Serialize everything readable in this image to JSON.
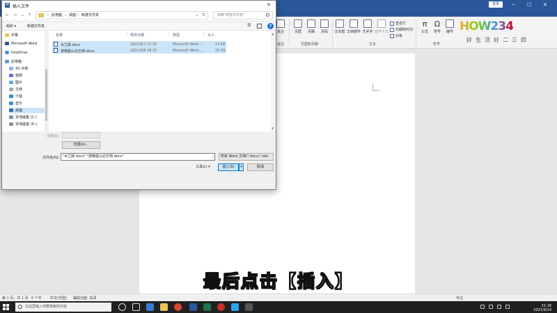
{
  "word": {
    "login_label": "登录",
    "ribbon_groups": {
      "comment": "批注",
      "header_footer": "页眉和页脚",
      "text": "文本",
      "symbol": "符号"
    },
    "ribbon_buttons": {
      "comment": "批注",
      "header": "页眉",
      "footer": "页脚",
      "page_number": "页码",
      "textbox": "文本框",
      "doc_parts": "文档部件",
      "wordart": "艺术字",
      "dropcap": "首字下沉",
      "signature_line": "签名行",
      "date_time": "日期和时间",
      "object": "对象",
      "equation": "公式",
      "symbol": "符号",
      "number": "编号"
    },
    "logo_text": "HOW234",
    "logo_sub": "好生活好二三四"
  },
  "dialog": {
    "title": "插入文件",
    "close_glyph": "✕",
    "breadcrumbs": [
      "此电脑",
      "桌面",
      "新建文件夹"
    ],
    "search_placeholder": "搜索\"新建文件夹\"",
    "organize_label": "组织 ▾",
    "new_folder_label": "新建文件夹",
    "nav_items": [
      {
        "label": "字幕",
        "icon": "folder-icon"
      },
      {
        "label": "Microsoft Word",
        "icon": "word-icon"
      },
      {
        "label": "OneDrive",
        "icon": "cloud-icon"
      },
      {
        "label": "此电脑",
        "icon": "computer-icon"
      },
      {
        "label": "3D 对象",
        "icon": "cube-icon"
      },
      {
        "label": "视频",
        "icon": "video-icon"
      },
      {
        "label": "图片",
        "icon": "picture-icon"
      },
      {
        "label": "文档",
        "icon": "document-icon"
      },
      {
        "label": "下载",
        "icon": "download-icon"
      },
      {
        "label": "音乐",
        "icon": "music-icon"
      },
      {
        "label": "桌面",
        "icon": "desktop-icon"
      },
      {
        "label": "本地磁盘 (C:)",
        "icon": "drive-icon"
      },
      {
        "label": "本地磁盘 (D:)",
        "icon": "drive-icon"
      }
    ],
    "columns": {
      "name": "名称",
      "modified": "修改日期",
      "type": "类型",
      "size": "大小"
    },
    "files": [
      {
        "name": "木兰辞.docx",
        "modified": "2021/9/7 22:33",
        "type": "Microsoft Word ...",
        "size": "14 KB"
      },
      {
        "name": "游黄庭山记文档.docx",
        "modified": "2021/9/8 18:37",
        "type": "Microsoft Word ...",
        "size": "25 KB"
      }
    ],
    "range_label": "范围(R):",
    "range_button": "范围(A)...",
    "filename_label": "文件名(N):",
    "filename_value": "\"木兰辞.docx\" \"游黄庭山记文档.docx\"",
    "filetype_value": "所有 Word 文档(*.docx;*.doc",
    "tools_label": "工具(L) ▾",
    "insert_label": "插入(S)",
    "cancel_label": "取消"
  },
  "subtitle": "最后点击【插入】",
  "statusbar": {
    "page": "第 1 页，共 1 页",
    "words": "0 个字",
    "lang": "中文(中国)",
    "accessibility": "辅助功能: 关闭",
    "focus": "专注"
  },
  "taskbar": {
    "search_placeholder": "在这里输入你要搜索的内容",
    "clock_time": "21:18",
    "clock_date": "2021/9/14"
  }
}
